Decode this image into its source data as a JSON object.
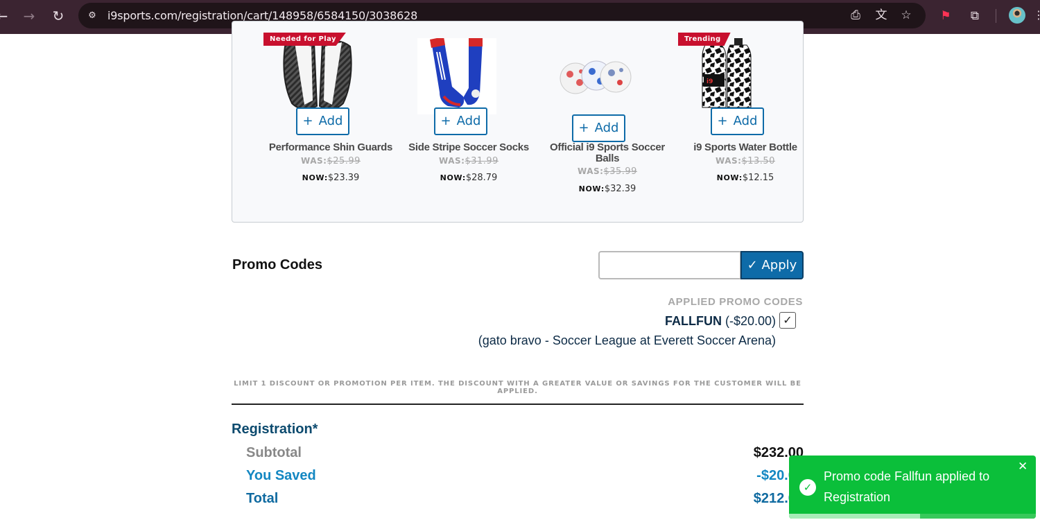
{
  "browser": {
    "url": "i9sports.com/registration/cart/148958/6584150/3038628",
    "icons": [
      "back-arrow-icon",
      "forward-arrow-icon",
      "reload-icon",
      "site-settings-icon",
      "install-app-icon",
      "translate-icon",
      "bookmark-star-icon",
      "extension-icon",
      "extensions-puzzle-icon",
      "profile-avatar",
      "more-menu-icon"
    ]
  },
  "addons": {
    "products": [
      {
        "badge": "Needed for Play",
        "add_label": "Add",
        "name": "Performance Shin Guards",
        "was_label": "WAS:",
        "was_price": "$25.99",
        "now_label": "NOW:",
        "now_price": "$23.39"
      },
      {
        "badge": "",
        "add_label": "Add",
        "name": "Side Stripe Soccer Socks",
        "was_label": "WAS:",
        "was_price": "$31.99",
        "now_label": "NOW:",
        "now_price": "$28.79"
      },
      {
        "badge": "",
        "add_label": "Add",
        "name": "Official i9 Sports Soccer Balls",
        "was_label": "WAS:",
        "was_price": "$35.99",
        "now_label": "NOW:",
        "now_price": "$32.39"
      },
      {
        "badge": "Trending",
        "add_label": "Add",
        "name": "i9 Sports Water Bottle",
        "was_label": "WAS:",
        "was_price": "$13.50",
        "now_label": "NOW:",
        "now_price": "$12.15"
      }
    ]
  },
  "promo": {
    "title": "Promo Codes",
    "input_value": "",
    "apply_label": "Apply",
    "applied_heading": "APPLIED PROMO CODES",
    "applied_code": "FALLFUN",
    "applied_amount": "(-$20.00)",
    "applied_description": "(gato bravo - Soccer League at Everett Soccer Arena)",
    "limit_note": "LIMIT 1 DISCOUNT OR PROMOTION PER ITEM. THE DISCOUNT WITH A GREATER VALUE OR SAVINGS FOR THE CUSTOMER WILL BE APPLIED."
  },
  "summary": {
    "title": "Registration*",
    "subtotal_label": "Subtotal",
    "subtotal_value": "$232.00",
    "saved_label": "You Saved",
    "saved_value": "-$20.00",
    "total_label": "Total",
    "total_value": "$212.00"
  },
  "toast": {
    "message": "Promo code Fallfun applied to Registration",
    "close_symbol": "✕",
    "progress": 0.53
  },
  "colors": {
    "accent": "#0e6ba8",
    "badge_red": "#c8102e",
    "toast_green": "#0bbf3a"
  }
}
